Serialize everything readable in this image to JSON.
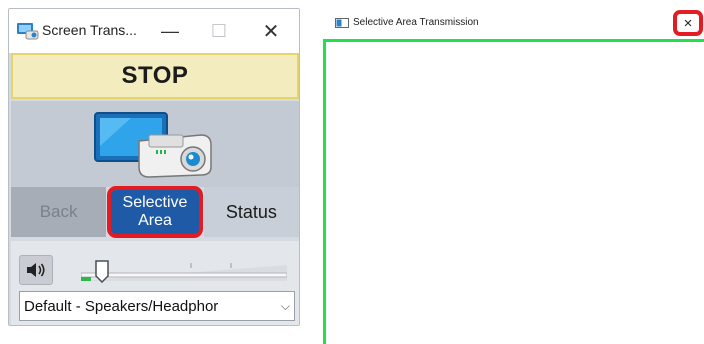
{
  "app": {
    "title": "Screen Trans...",
    "stop_label": "STOP",
    "buttons": {
      "back": "Back",
      "selective": "Selective\nArea",
      "status": "Status"
    },
    "volume": {
      "level_fraction": 0.0
    },
    "audio_device": "Default - Speakers/Headphor"
  },
  "sat_window": {
    "title": "Selective Area Transmission",
    "close_label": "×"
  },
  "colors": {
    "highlight": "#e31c24",
    "selection_frame": "#22e04a",
    "selective_button": "#1f5aa6"
  }
}
